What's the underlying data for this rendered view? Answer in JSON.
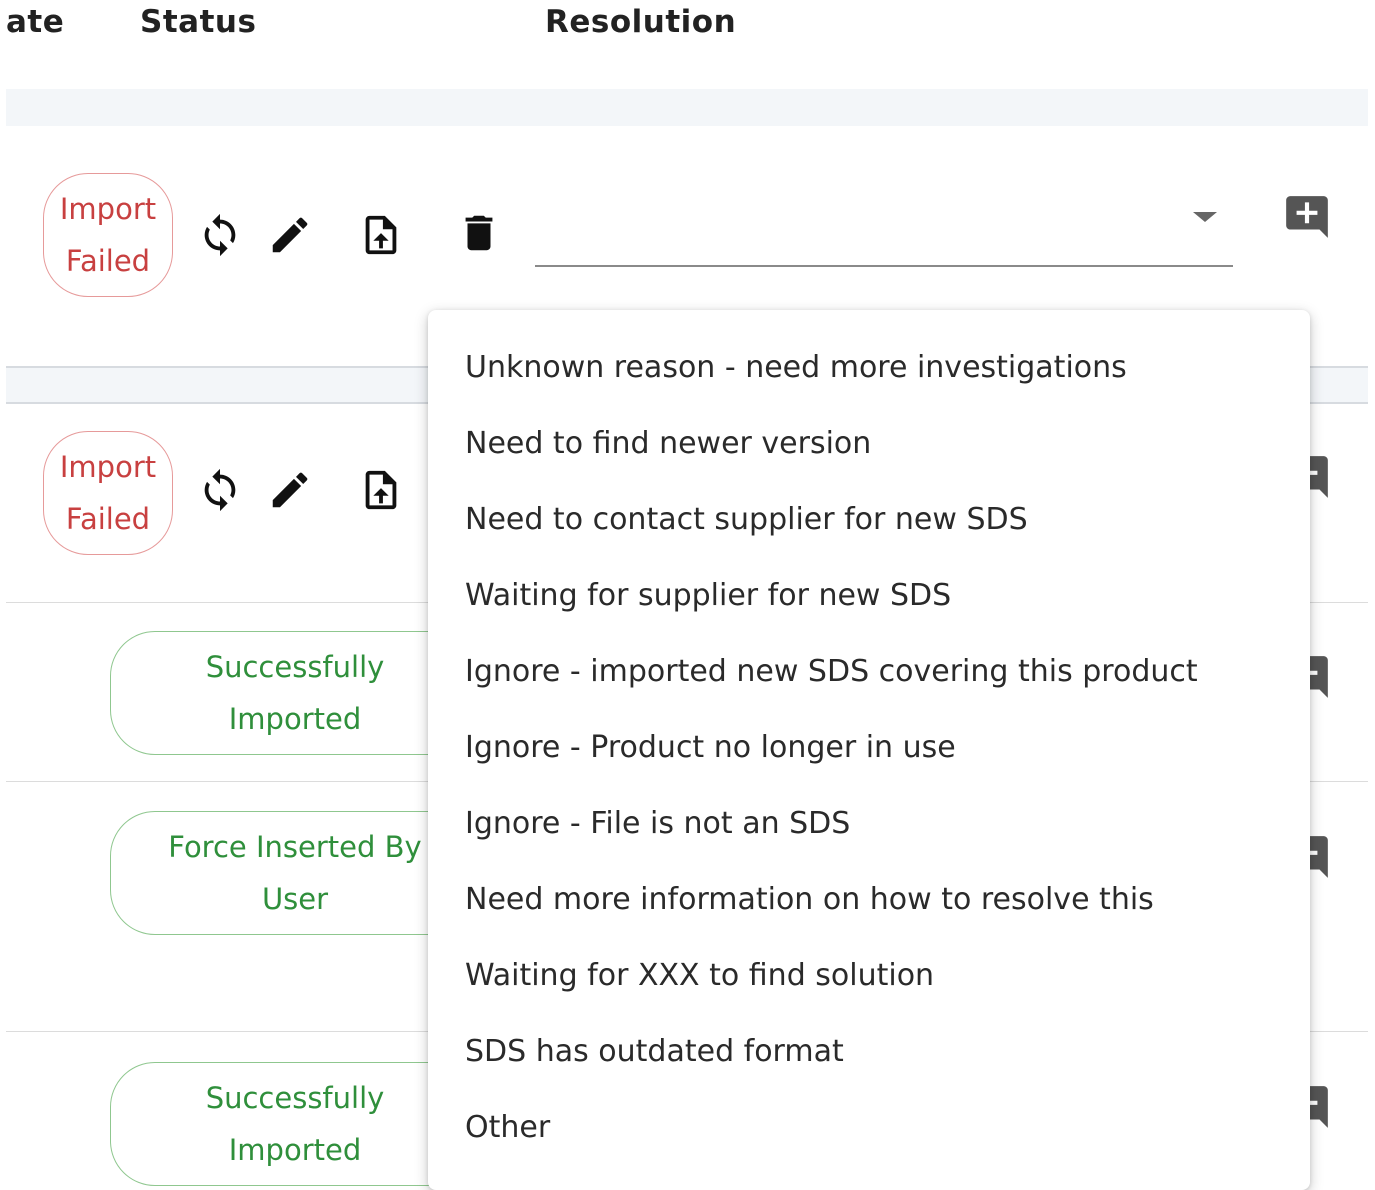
{
  "header": {
    "col_date": "ate",
    "col_status": "Status",
    "col_resolution": "Resolution"
  },
  "rows": [
    {
      "status_line1": "Import",
      "status_line2": "Failed",
      "status_type": "failed"
    },
    {
      "status_line1": "Import",
      "status_line2": "Failed",
      "status_type": "failed"
    },
    {
      "status_line1": "Successfully",
      "status_line2": "Imported",
      "status_type": "success"
    },
    {
      "status_line1": "Force Inserted By",
      "status_line2": "User",
      "status_type": "success"
    },
    {
      "status_line1": "Successfully",
      "status_line2": "Imported",
      "status_type": "success"
    }
  ],
  "resolution_select": {
    "value": ""
  },
  "resolution_options": [
    "Unknown reason - need more investigations",
    "Need to find newer version",
    "Need to contact supplier for new SDS",
    "Waiting for supplier for new SDS",
    "Ignore - imported new SDS covering this product",
    "Ignore - Product no longer in use",
    "Ignore - File is not an SDS",
    "Need more information on how to resolve this",
    "Waiting for XXX to find solution",
    "SDS has outdated format",
    "Other"
  ],
  "icons": {
    "retry": "sync-icon",
    "edit": "pencil-icon",
    "upload": "file-upload-icon",
    "delete": "trash-icon",
    "comment": "add-comment-icon"
  },
  "colors": {
    "failed_text": "#c84040",
    "failed_border": "#e69a9a",
    "success_text": "#2f8f3b",
    "success_border": "#8fc78f"
  }
}
